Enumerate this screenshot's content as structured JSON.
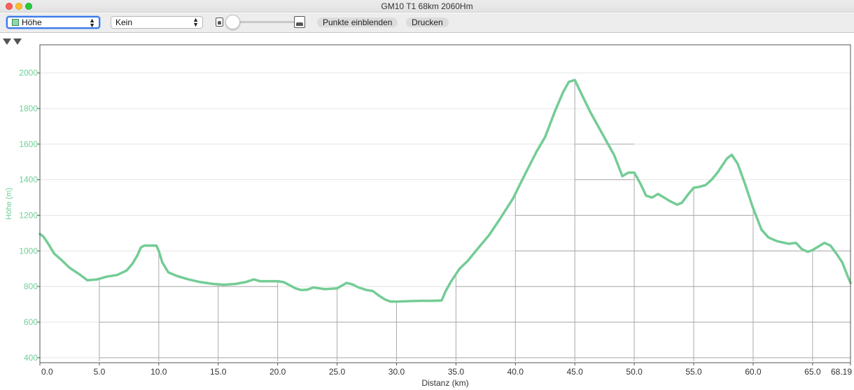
{
  "window": {
    "title": "GM10 T1 68km 2060Hm"
  },
  "toolbar": {
    "metric_select": {
      "value": "Höhe",
      "swatch_color": "#8fd8a8"
    },
    "secondary_select": {
      "value": "Kein"
    },
    "points_button": "Punkte einblenden",
    "print_button": "Drucken",
    "zoom_slider_value": 0
  },
  "colors": {
    "line": "#74cc95",
    "axis_label": "#6fcf97",
    "grid": "#e4e4e4",
    "drop_lines": "#aaaaaa"
  },
  "chart_data": {
    "type": "area",
    "xlabel": "Distanz (km)",
    "ylabel": "Höhe (m)",
    "xlim": [
      0,
      68.19
    ],
    "ylim": [
      380,
      2150
    ],
    "x_ticks": [
      0,
      5,
      10,
      15,
      20,
      25,
      30,
      35,
      40,
      45,
      50,
      55,
      60,
      65,
      68.19
    ],
    "x_tick_labels": [
      "0.0",
      "5.0",
      "10.0",
      "15.0",
      "20.0",
      "25.0",
      "30.0",
      "35.0",
      "40.0",
      "45.0",
      "50.0",
      "55.0",
      "60.0",
      "65.0",
      "68.19"
    ],
    "y_ticks": [
      400,
      600,
      800,
      1000,
      1200,
      1400,
      1600,
      1800,
      2000
    ],
    "y_tick_labels": [
      "400",
      "600",
      "800",
      "1000",
      "1200",
      "1400",
      "1600",
      "1800",
      "2000"
    ],
    "grid": true,
    "series": [
      {
        "x": [
          0,
          0.3,
          0.7,
          1.2,
          1.8,
          2.5,
          3.3,
          4.0,
          4.8,
          5.6,
          6.5,
          7.3,
          7.8,
          8.2,
          8.5,
          8.8,
          9.3,
          9.8,
          10.0,
          10.3,
          10.8,
          11.5,
          12.5,
          13.5,
          14.5,
          15.5,
          16.5,
          17.3,
          18.0,
          18.5,
          19.0,
          20.0,
          20.5,
          21.0,
          21.5,
          22.0,
          22.5,
          23.0,
          23.5,
          24.0,
          25.0,
          25.8,
          26.3,
          26.8,
          27.5,
          28.0,
          28.5,
          29.0,
          29.5,
          30.0,
          31.0,
          32.0,
          33.0,
          33.8,
          34.1,
          34.6,
          35.3,
          36.0,
          36.8,
          37.8,
          38.8,
          39.8,
          40.8,
          41.8,
          42.5,
          43.3,
          44.0,
          44.5,
          45.0,
          45.5,
          46.3,
          47.3,
          48.3,
          49.0,
          49.5,
          50.0,
          50.5,
          51.0,
          51.5,
          52.0,
          52.5,
          53.0,
          53.6,
          54.0,
          54.5,
          55.0,
          55.5,
          56.0,
          56.5,
          57.0,
          57.5,
          57.8,
          58.2,
          58.7,
          59.3,
          60.0,
          60.7,
          61.3,
          62.0,
          63.0,
          63.6,
          64.1,
          64.6,
          65.0,
          65.5,
          66.0,
          66.5,
          67.0,
          67.5,
          68.0,
          68.19
        ],
        "values": [
          1095,
          1080,
          1040,
          985,
          950,
          905,
          870,
          835,
          840,
          855,
          865,
          890,
          930,
          975,
          1020,
          1030,
          1030,
          1030,
          1000,
          935,
          880,
          860,
          840,
          825,
          815,
          810,
          815,
          825,
          840,
          830,
          830,
          830,
          825,
          808,
          790,
          780,
          782,
          795,
          790,
          785,
          790,
          820,
          812,
          795,
          780,
          775,
          750,
          728,
          715,
          715,
          718,
          720,
          720,
          722,
          770,
          830,
          900,
          945,
          1010,
          1090,
          1190,
          1295,
          1430,
          1560,
          1640,
          1780,
          1890,
          1950,
          1960,
          1890,
          1780,
          1660,
          1540,
          1420,
          1440,
          1440,
          1380,
          1310,
          1300,
          1320,
          1300,
          1280,
          1260,
          1270,
          1315,
          1355,
          1360,
          1370,
          1400,
          1440,
          1490,
          1520,
          1540,
          1490,
          1380,
          1240,
          1120,
          1075,
          1055,
          1040,
          1045,
          1010,
          995,
          1005,
          1025,
          1045,
          1030,
          985,
          935,
          850,
          820
        ]
      }
    ]
  }
}
